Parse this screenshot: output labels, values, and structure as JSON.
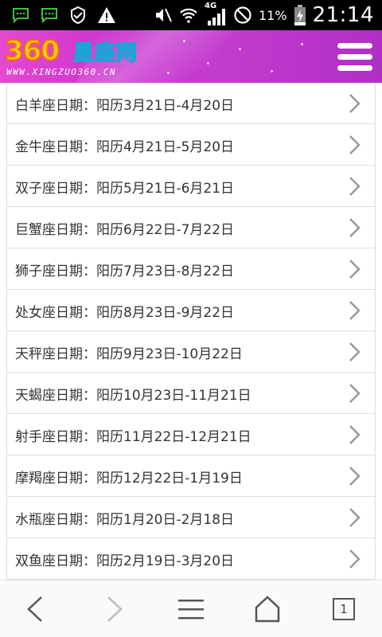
{
  "status_bar": {
    "battery_percent": "11%",
    "time": "21:14",
    "network": "4G",
    "icons": [
      "chat-icon",
      "chat-icon",
      "shield-check-icon",
      "warning-icon",
      "mute-icon",
      "wifi-icon",
      "signal-icon",
      "no-sim-icon",
      "battery-charging-icon"
    ]
  },
  "header": {
    "logo_number": "360",
    "logo_chinese": "星座网",
    "logo_url": "WWW.XINGZUO360.CN",
    "menu_icon": "hamburger-menu-icon",
    "colors": {
      "bg_left": "#e34ad0",
      "bg_right": "#b02fc4",
      "logo_orange": "#ff6a00",
      "logo_yellow": "#ffcc22",
      "logo_blue": "#19a5d8"
    }
  },
  "list": {
    "items": [
      {
        "label": "白羊座日期：阳历3月21日-4月20日"
      },
      {
        "label": "金牛座日期：阳历4月21日-5月20日"
      },
      {
        "label": "双子座日期：阳历5月21日-6月21日"
      },
      {
        "label": "巨蟹座日期：阳历6月22日-7月22日"
      },
      {
        "label": "狮子座日期：阳历7月23日-8月22日"
      },
      {
        "label": "处女座日期：阳历8月23日-9月22日"
      },
      {
        "label": "天秤座日期：阳历9月23日-10月22日"
      },
      {
        "label": "天蝎座日期：阳历10月23日-11月21日"
      },
      {
        "label": "射手座日期：阳历11月22日-12月21日"
      },
      {
        "label": "摩羯座日期：阳历12月22日-1月19日"
      },
      {
        "label": "水瓶座日期：阳历1月20日-2月18日"
      },
      {
        "label": "双鱼座日期：阳历2月19日-3月20日"
      }
    ]
  },
  "bottom_bar": {
    "buttons": [
      "back-icon",
      "forward-icon",
      "menu-icon",
      "home-icon",
      "tabs-icon"
    ],
    "tab_count": "1"
  }
}
